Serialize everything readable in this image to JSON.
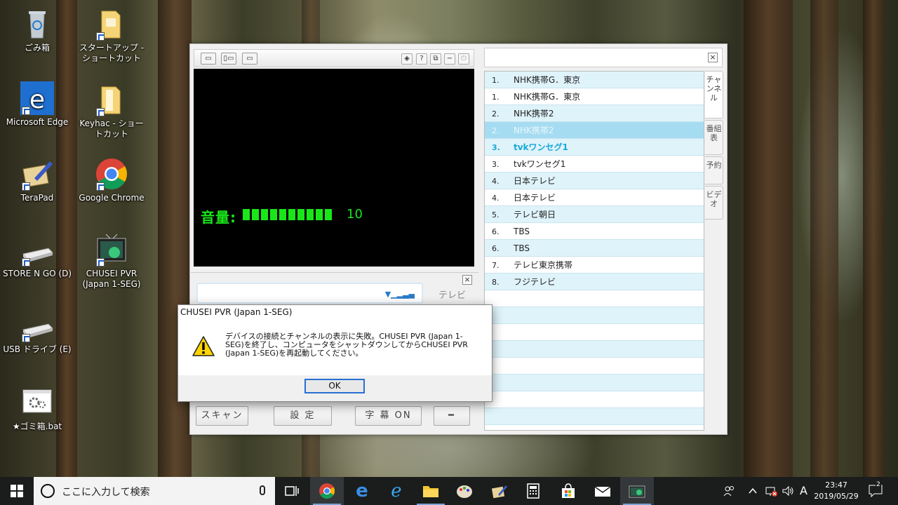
{
  "desktop": {
    "icons": [
      {
        "label": "ごみ箱",
        "icon": "recycle-bin-icon"
      },
      {
        "label": "スタートアップ - ショートカット",
        "icon": "folder-shortcut-icon"
      },
      {
        "label": "Microsoft Edge",
        "icon": "edge-icon"
      },
      {
        "label": "Keyhac - ショートカット",
        "icon": "folder-shortcut-icon"
      },
      {
        "label": "TeraPad",
        "icon": "terapad-icon"
      },
      {
        "label": "Google Chrome",
        "icon": "chrome-icon"
      },
      {
        "label": "STORE N GO (D)",
        "icon": "drive-icon"
      },
      {
        "label": "CHUSEI PVR (Japan 1-SEG)",
        "icon": "tv-app-icon"
      },
      {
        "label": "USB ドライブ (E)",
        "icon": "usb-drive-icon"
      },
      {
        "label": "★ゴミ箱.bat",
        "icon": "batch-file-icon"
      }
    ]
  },
  "player": {
    "toolbar_right": [
      "◈",
      "?",
      "⧉",
      "−",
      "⏻"
    ],
    "volume_label": "音量:",
    "volume_value": "10",
    "volume_level": 10,
    "tv_label": "テレビ",
    "buttons": {
      "scan": "スキャン",
      "settings": "設 定",
      "subtitles": "字 幕  ON",
      "minus": "━"
    }
  },
  "channel_panel": {
    "close": "×",
    "tabs": [
      "チャンネル",
      "番組表",
      "予約",
      "ビデオ"
    ],
    "channels": [
      {
        "num": "1.",
        "name": "NHK携帯G．東京"
      },
      {
        "num": "1.",
        "name": "NHK携帯G．東京"
      },
      {
        "num": "2.",
        "name": "NHK携帯2"
      },
      {
        "num": "2.",
        "name": "NHK携帯2"
      },
      {
        "num": "3.",
        "name": "tvkワンセグ1"
      },
      {
        "num": "3.",
        "name": "tvkワンセグ1"
      },
      {
        "num": "4.",
        "name": "日本テレビ"
      },
      {
        "num": "4.",
        "name": "日本テレビ"
      },
      {
        "num": "5.",
        "name": "テレビ朝日"
      },
      {
        "num": "6.",
        "name": "TBS"
      },
      {
        "num": "6.",
        "name": "TBS"
      },
      {
        "num": "7.",
        "name": "テレビ東京携帯"
      },
      {
        "num": "8.",
        "name": "フジテレビ"
      }
    ],
    "empty_rows": 8
  },
  "dialog": {
    "title": "CHUSEI PVR (Japan 1-SEG)",
    "message": "デバイスの接続とチャンネルの表示に失敗。CHUSEI PVR (Japan 1-SEG)を終了し、コンピュータをシャットダウンしてからCHUSEI PVR (Japan 1-SEG)を再起動してください。",
    "ok_label": "OK"
  },
  "taskbar": {
    "search_placeholder": "ここに入力して検索",
    "time": "23:47",
    "date": "2019/05/29",
    "ime": "A",
    "notification_count": "2",
    "colors": {
      "background": "#1a1d1c",
      "accent": "#2870d4"
    }
  }
}
